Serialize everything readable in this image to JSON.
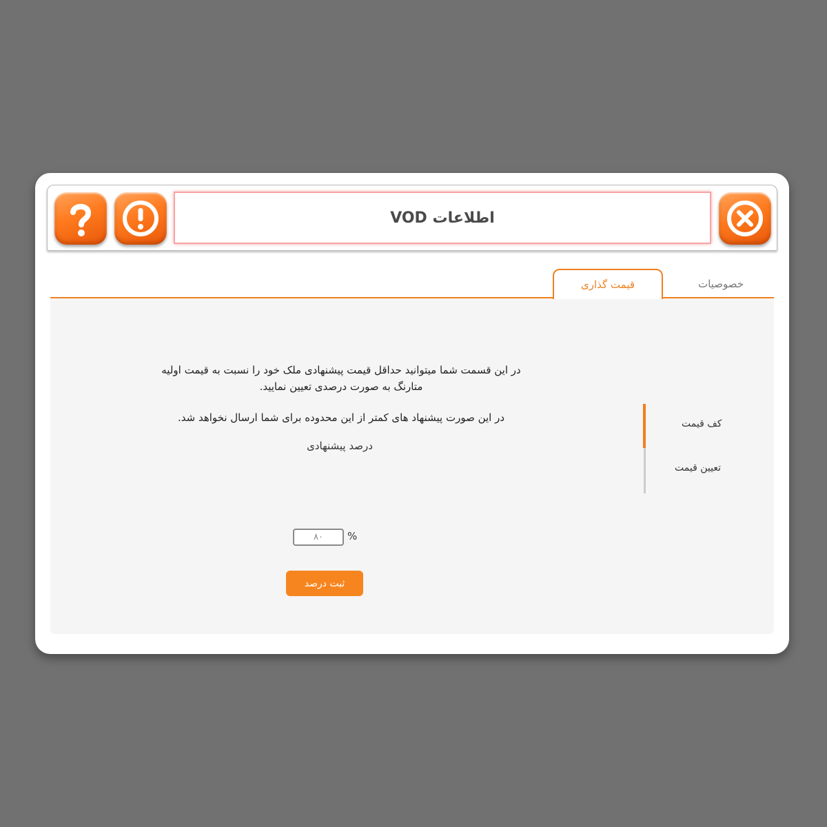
{
  "window": {
    "title": "اطلاعات VOD",
    "icons": {
      "help": "question-mark-icon",
      "info": "exclamation-icon",
      "close": "close-icon"
    }
  },
  "tabs": [
    {
      "label": "خصوصیات",
      "active": false
    },
    {
      "label": "قیمت گذاری",
      "active": true
    }
  ],
  "side_menu": {
    "items": [
      {
        "label": "کف قیمت",
        "active": true
      },
      {
        "label": "تعیین قیمت",
        "active": false
      }
    ]
  },
  "main": {
    "description_line1": "در این قسمت شما میتوانید حداقل قیمت پیشنهادی ملک خود را نسبت به قیمت اولیه",
    "description_line2": "متارنگ به صورت درصدی تعیین نمایید.",
    "note": "در این صورت پیشنهاد های کمتر از این محدوده برای شما ارسال نخواهد شد.",
    "percent_label": "درصد پیشنهادی",
    "percent_value": "۸۰",
    "percent_sign": "%",
    "submit_label": "ثبت درصد"
  },
  "colors": {
    "accent": "#f07f1f",
    "background": "#717171",
    "panel": "#f5f5f5"
  }
}
